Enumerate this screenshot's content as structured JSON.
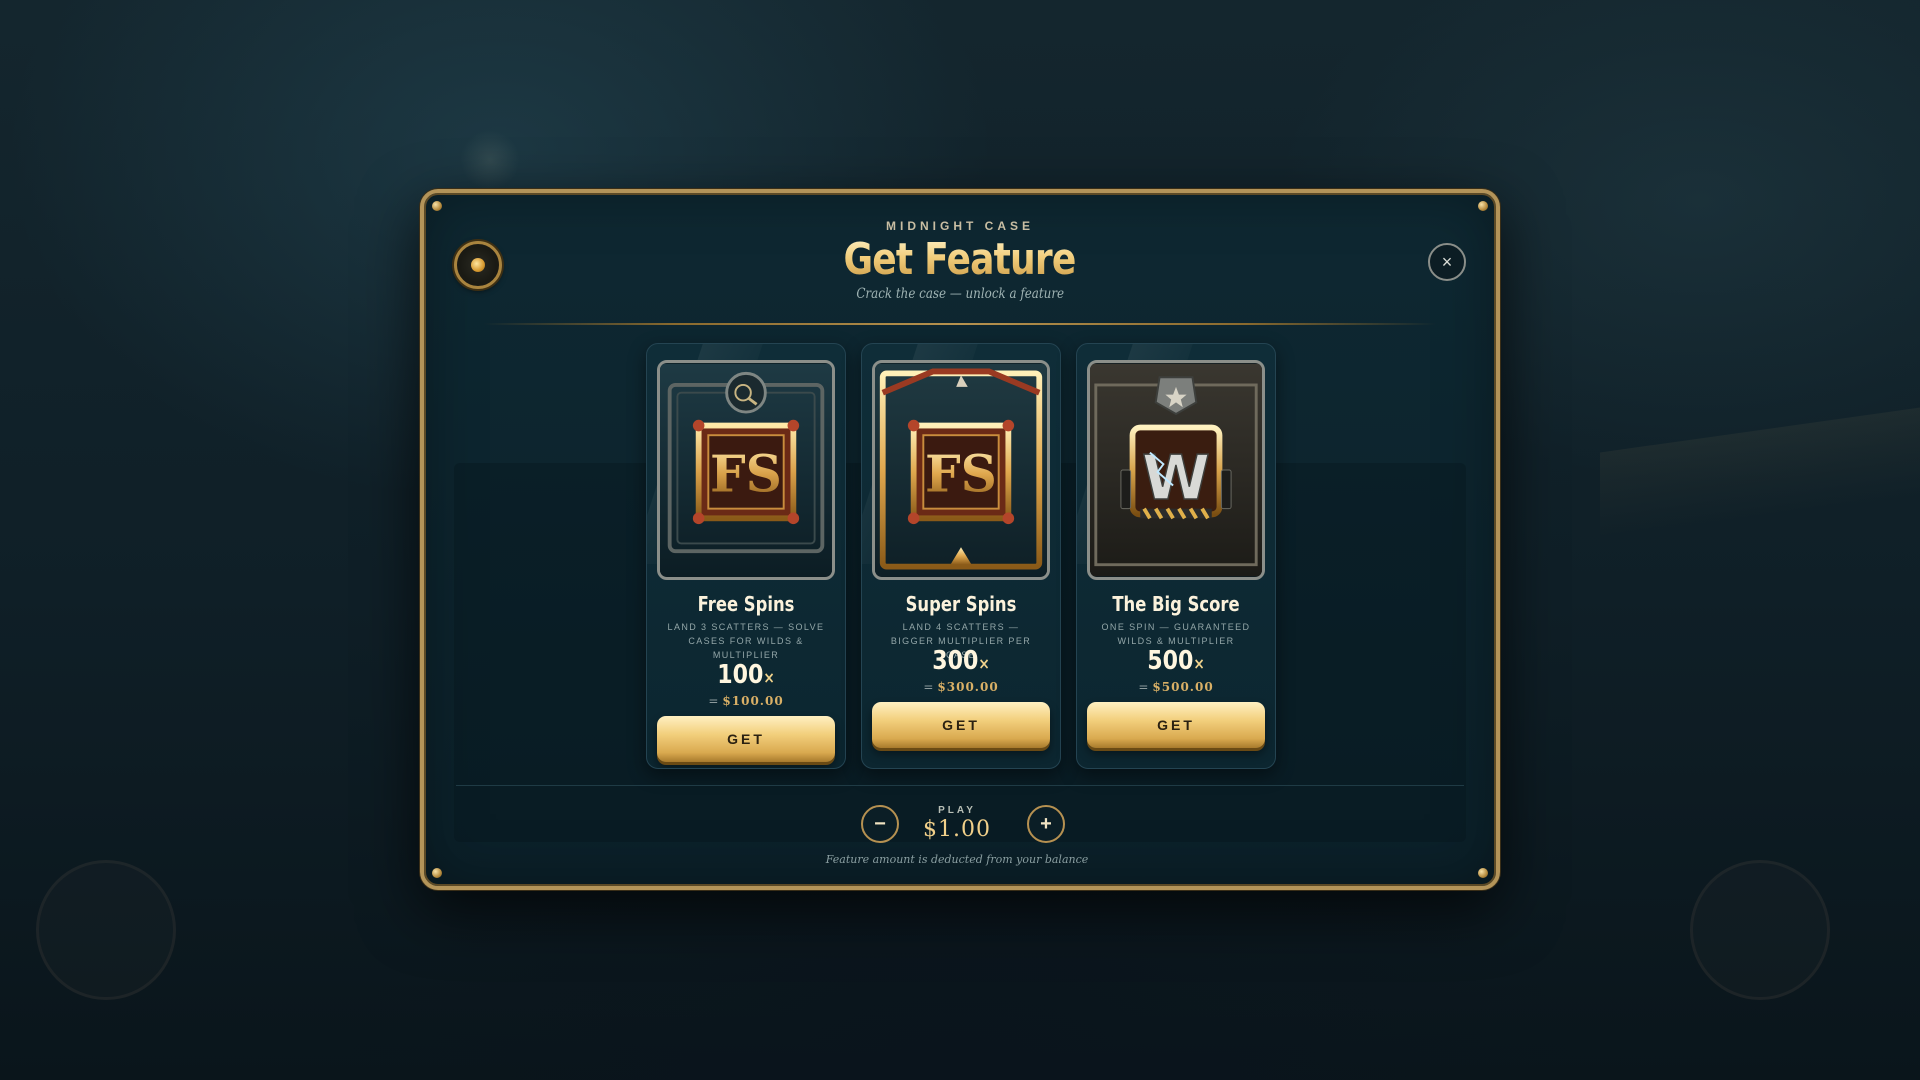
{
  "modal": {
    "brand": "MIDNIGHT CASE",
    "title": "Get Feature",
    "subtitle": "Crack the case — unlock a feature",
    "close_label": "×"
  },
  "features": [
    {
      "name": "Free Spins",
      "description": "LAND 3 SCATTERS — SOLVE CASES FOR WILDS & MULTIPLIER",
      "multiplier": "100",
      "multiplier_suffix": "×",
      "amount_prefix": "=",
      "amount": "$100.00",
      "button_label": "GET",
      "icon": "free-spins-icon",
      "art_text": "FS"
    },
    {
      "name": "Super Spins",
      "description": "LAND 4 SCATTERS — BIGGER MULTIPLIER PER CASE",
      "multiplier": "300",
      "multiplier_suffix": "×",
      "amount_prefix": "=",
      "amount": "$300.00",
      "button_label": "GET",
      "icon": "super-spins-icon",
      "art_text": "FS"
    },
    {
      "name": "The Big Score",
      "description": "ONE SPIN — GUARANTEED WILDS & MULTIPLIER",
      "multiplier": "500",
      "multiplier_suffix": "×",
      "amount_prefix": "=",
      "amount": "$500.00",
      "button_label": "GET",
      "icon": "big-score-icon",
      "art_text": "W"
    }
  ],
  "play": {
    "label": "PLAY",
    "value": "$1.00",
    "minus_label": "−",
    "plus_label": "+",
    "note": "Feature amount is deducted from your balance"
  },
  "colors": {
    "gold": "#d9a94f",
    "frame": "#b39459",
    "panel": "#0e2832"
  }
}
